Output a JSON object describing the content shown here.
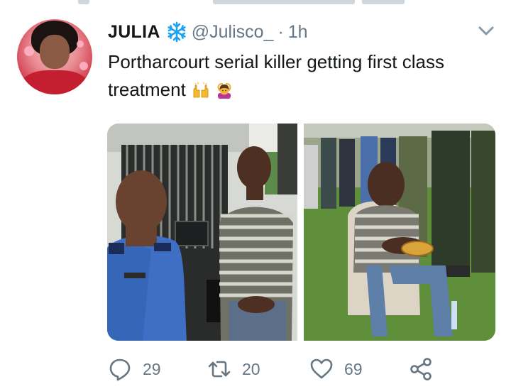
{
  "tweet": {
    "author": {
      "display_name": "JULIA",
      "handle": "@Julisco_",
      "separator": "·",
      "time": "1h",
      "name_badge": "snowflake-emoji"
    },
    "text": "Portharcourt serial killer getting first class treatment",
    "text_emojis": [
      "raising-hands-emoji",
      "woman-gesturing-ok-emoji"
    ],
    "media": {
      "count": 2,
      "images": [
        "police-officer-and-suspect-photo",
        "suspect-eating-on-chair-photo"
      ]
    },
    "actions": {
      "reply_count": "29",
      "retweet_count": "20",
      "like_count": "69"
    },
    "colors": {
      "text": "#14171a",
      "secondary": "#657786",
      "snowflake": "#1da1f2",
      "icon": "#66757f"
    }
  }
}
